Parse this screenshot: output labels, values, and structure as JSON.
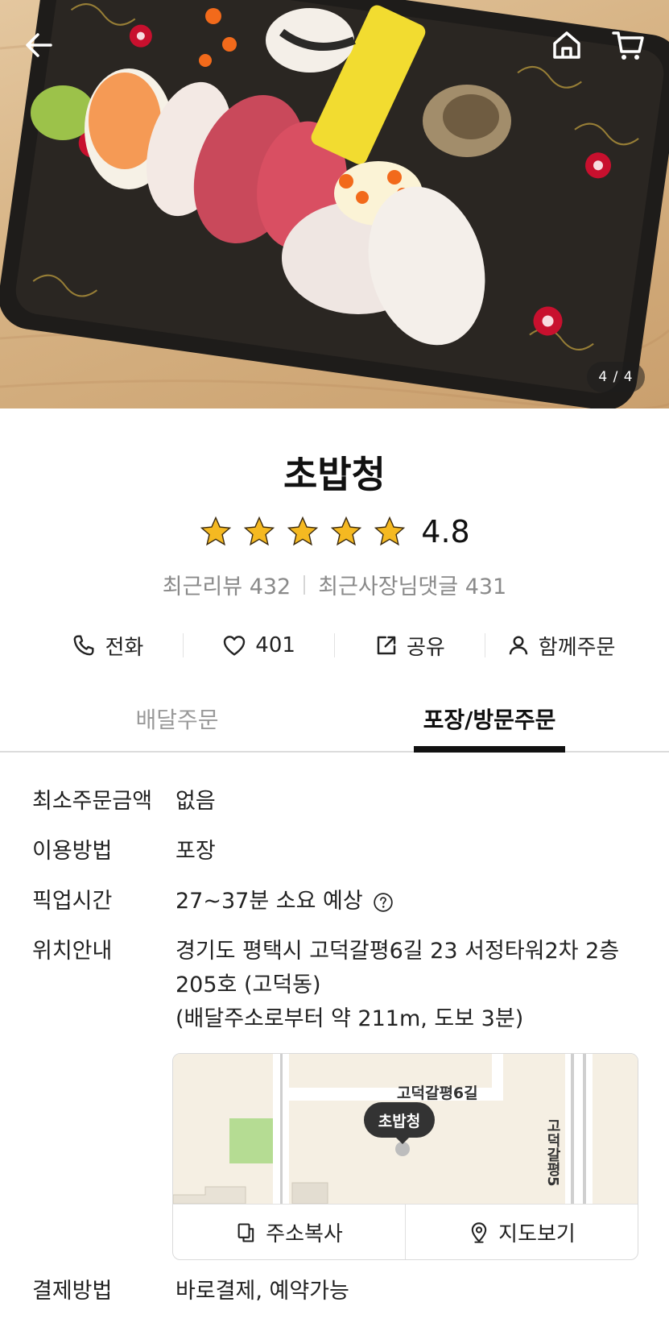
{
  "hero": {
    "image_alt": "",
    "counter": "4 / 4",
    "back_icon": "arrow-left-icon",
    "home_icon": "home-icon",
    "cart_icon": "cart-icon"
  },
  "store": {
    "name": "초밥청",
    "rating": "4.8",
    "stars": 5,
    "recent_reviews": "최근리뷰 432",
    "owner_replies": "최근사장님댓글 431"
  },
  "actions": {
    "call": "전화",
    "likes": "401",
    "share": "공유",
    "group_order": "함께주문"
  },
  "tabs": {
    "delivery": "배달주문",
    "pickup": "포장/방문주문"
  },
  "info": {
    "min_order_label": "최소주문금액",
    "min_order_value": "없음",
    "method_label": "이용방법",
    "method_value": "포장",
    "pickup_time_label": "픽업시간",
    "pickup_time_value": "27~37분 소요 예상",
    "location_label": "위치안내",
    "location_address": "경기도 평택시 고덕갈평6길 23 서정타워2차 2층 205호 (고덕동)",
    "location_distance": "(배달주소로부터 약 211m, 도보 3분)",
    "payment_label": "결제방법",
    "payment_value": "바로결제, 예약가능"
  },
  "map": {
    "street_horizontal": "고덕갈평6길",
    "street_vertical": "고덕갈평5",
    "pin_label": "초밥청",
    "copy_address": "주소복사",
    "view_map": "지도보기"
  },
  "colors": {
    "star": "#f5b921",
    "accent_tab": "#111111",
    "muted": "#8a8a8a"
  }
}
